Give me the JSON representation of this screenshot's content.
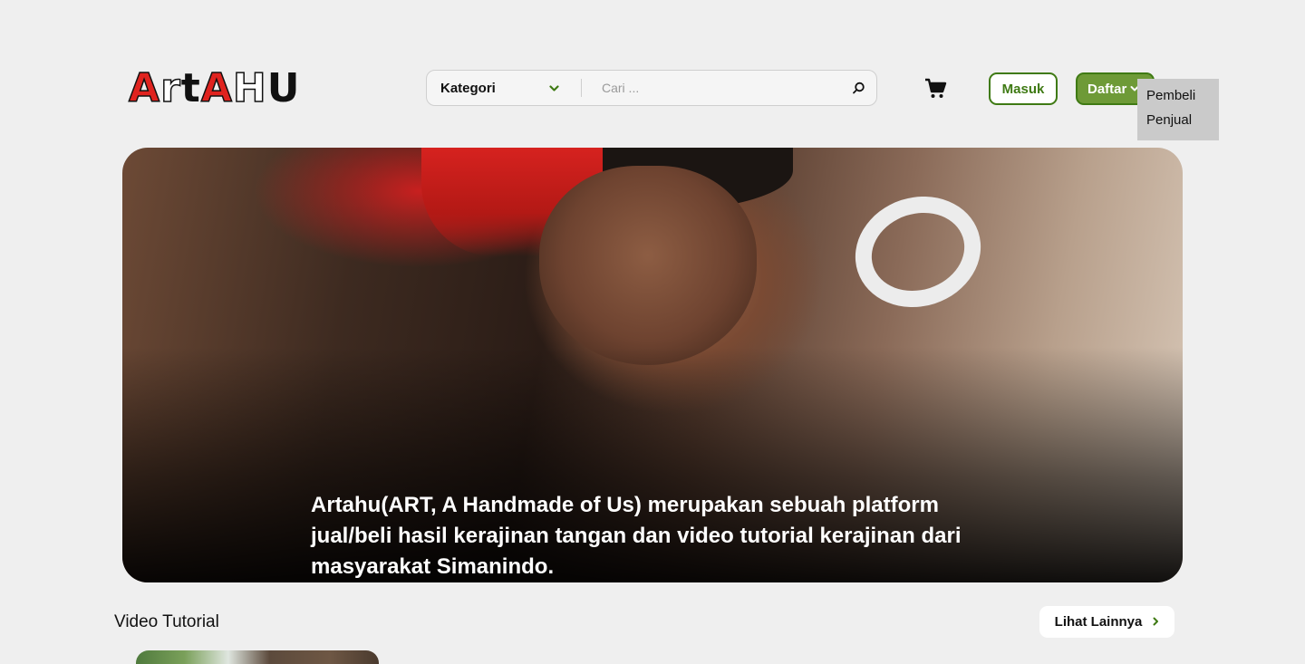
{
  "logo": {
    "letters": [
      {
        "char": "A",
        "style": "red"
      },
      {
        "char": "r",
        "style": "white"
      },
      {
        "char": "t",
        "style": "black"
      },
      {
        "char": "A",
        "style": "red"
      },
      {
        "char": "H",
        "style": "white"
      },
      {
        "char": "U",
        "style": "black"
      }
    ]
  },
  "search": {
    "category_label": "Kategori",
    "placeholder": "Cari ...",
    "category_icon": "chevron-down-icon",
    "search_icon": "search-icon"
  },
  "header": {
    "cart_icon": "cart-icon",
    "login_label": "Masuk",
    "register_label": "Daftar"
  },
  "register_menu": {
    "items": [
      "Pembeli",
      "Penjual"
    ]
  },
  "hero": {
    "caption": "Artahu(ART, A Handmade of Us) merupakan sebuah platform jual/beli hasil kerajinan tangan dan video tutorial kerajinan dari masyarakat Simanindo."
  },
  "video_section": {
    "title": "Video Tutorial",
    "see_more_label": "Lihat Lainnya"
  },
  "colors": {
    "accent_green": "#3f7a14",
    "button_green": "#6e9a37",
    "logo_red": "#e0231f",
    "background": "#efefef"
  }
}
